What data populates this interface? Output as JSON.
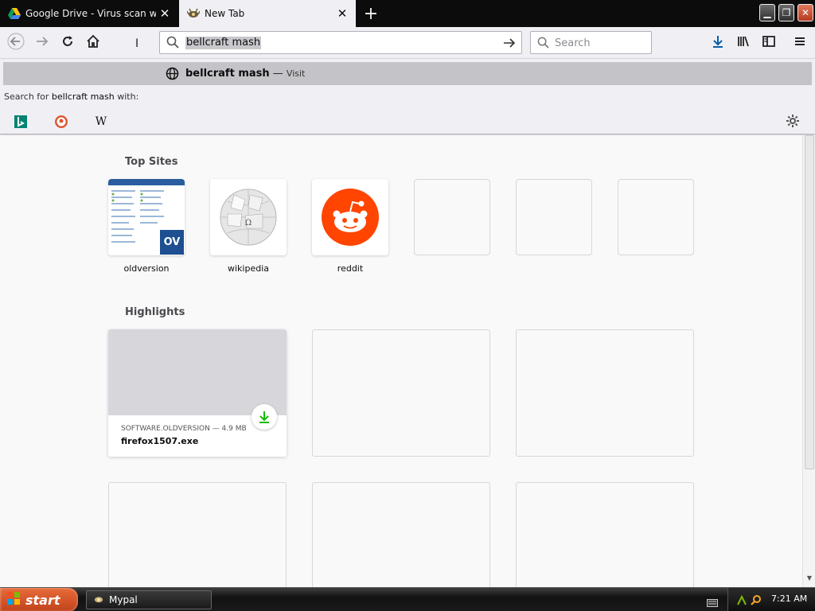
{
  "tabs": [
    {
      "title": "Google Drive - Virus scan warning",
      "active": false,
      "icon": "google-drive-icon"
    },
    {
      "title": "New Tab",
      "active": true,
      "icon": "new-tab-icon"
    }
  ],
  "navbar": {
    "url_value": "bellcraft mash",
    "search_placeholder": "Search"
  },
  "dropdown": {
    "suggestion_text": "bellcraft mash",
    "suggestion_dash": " — ",
    "suggestion_action": "Visit",
    "search_for_prefix": "Search for ",
    "search_for_term": "bellcraft mash",
    "search_for_suffix": " with:",
    "engines": [
      "bing-icon",
      "duckduckgo-icon",
      "wikipedia-icon"
    ]
  },
  "newtab": {
    "top_sites_title": "Top Sites",
    "top_sites": [
      {
        "label": "oldversion",
        "badge": "OV"
      },
      {
        "label": "wikipedia",
        "badge": "Ω"
      },
      {
        "label": "reddit",
        "badge": ""
      }
    ],
    "highlights_title": "Highlights",
    "highlight": {
      "source": "SOFTWARE.OLDVERSION — 4.9 MB",
      "title": "firefox1507.exe"
    }
  },
  "taskbar": {
    "start_label": "start",
    "task_label": "Mypal",
    "clock": "7:21 AM"
  },
  "colors": {
    "tabstrip": "#0c0c0d",
    "toolbar": "#f0f0f4",
    "reddit": "#ff4500",
    "download_green": "#12bc00",
    "oldversion_blue": "#1d4f91",
    "start_orange": "#c0421a"
  }
}
